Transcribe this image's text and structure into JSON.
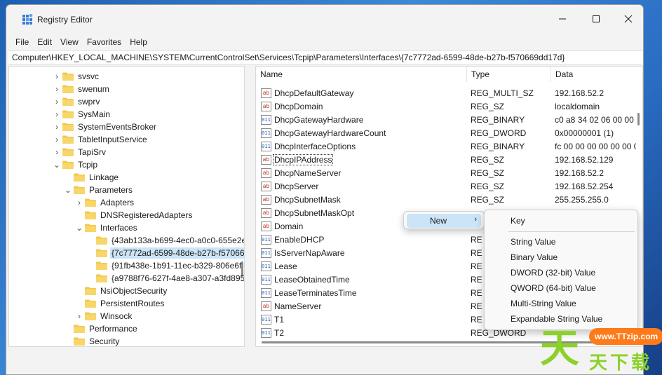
{
  "window": {
    "title": "Registry Editor",
    "controls": {
      "minimize": "—",
      "maximize": "☐",
      "close": "✕"
    }
  },
  "menubar": [
    "File",
    "Edit",
    "View",
    "Favorites",
    "Help"
  ],
  "address": "Computer\\HKEY_LOCAL_MACHINE\\SYSTEM\\CurrentControlSet\\Services\\Tcpip\\Parameters\\Interfaces\\{7c7772ad-6599-48de-b27b-f570669dd17d}",
  "tree": [
    {
      "label": "svsvc",
      "level": 0,
      "expander": "›"
    },
    {
      "label": "swenum",
      "level": 0,
      "expander": "›"
    },
    {
      "label": "swprv",
      "level": 0,
      "expander": "›"
    },
    {
      "label": "SysMain",
      "level": 0,
      "expander": "›"
    },
    {
      "label": "SystemEventsBroker",
      "level": 0,
      "expander": "›"
    },
    {
      "label": "TabletInputService",
      "level": 0,
      "expander": "›"
    },
    {
      "label": "TapiSrv",
      "level": 0,
      "expander": "›"
    },
    {
      "label": "Tcpip",
      "level": 0,
      "expander": "⌄"
    },
    {
      "label": "Linkage",
      "level": 1,
      "expander": ""
    },
    {
      "label": "Parameters",
      "level": 1,
      "expander": "⌄"
    },
    {
      "label": "Adapters",
      "level": 2,
      "expander": "›"
    },
    {
      "label": "DNSRegisteredAdapters",
      "level": 2,
      "expander": ""
    },
    {
      "label": "Interfaces",
      "level": 2,
      "expander": "⌄"
    },
    {
      "label": "{43ab133a-b699-4ec0-a0c0-655e2e",
      "level": 3,
      "expander": ""
    },
    {
      "label": "{7c7772ad-6599-48de-b27b-f57066",
      "level": 3,
      "expander": "",
      "selected": true
    },
    {
      "label": "{91fb438e-1b91-11ec-b329-806e6f",
      "level": 3,
      "expander": ""
    },
    {
      "label": "{a9788f76-627f-4ae8-a307-a3fd895",
      "level": 3,
      "expander": ""
    },
    {
      "label": "NsiObjectSecurity",
      "level": 2,
      "expander": ""
    },
    {
      "label": "PersistentRoutes",
      "level": 2,
      "expander": ""
    },
    {
      "label": "Winsock",
      "level": 2,
      "expander": "›"
    },
    {
      "label": "Performance",
      "level": 1,
      "expander": ""
    },
    {
      "label": "Security",
      "level": 1,
      "expander": ""
    }
  ],
  "list": {
    "columns": [
      "Name",
      "Type",
      "Data"
    ],
    "rows": [
      {
        "name": "DhcpDefaultGateway",
        "type": "REG_MULTI_SZ",
        "data": "192.168.52.2",
        "icon": "sz"
      },
      {
        "name": "DhcpDomain",
        "type": "REG_SZ",
        "data": "localdomain",
        "icon": "sz"
      },
      {
        "name": "DhcpGatewayHardware",
        "type": "REG_BINARY",
        "data": "c0 a8 34 02 06 00 00 0",
        "icon": "bin"
      },
      {
        "name": "DhcpGatewayHardwareCount",
        "type": "REG_DWORD",
        "data": "0x00000001 (1)",
        "icon": "bin"
      },
      {
        "name": "DhcpInterfaceOptions",
        "type": "REG_BINARY",
        "data": "fc 00 00 00 00 00 00 0",
        "icon": "bin"
      },
      {
        "name": "DhcpIPAddress",
        "type": "REG_SZ",
        "data": "192.168.52.129",
        "icon": "sz",
        "focused": true
      },
      {
        "name": "DhcpNameServer",
        "type": "REG_SZ",
        "data": "192.168.52.2",
        "icon": "sz"
      },
      {
        "name": "DhcpServer",
        "type": "REG_SZ",
        "data": "192.168.52.254",
        "icon": "sz"
      },
      {
        "name": "DhcpSubnetMask",
        "type": "REG_SZ",
        "data": "255.255.255.0",
        "icon": "sz"
      },
      {
        "name": "DhcpSubnetMaskOpt",
        "type": "",
        "data": "",
        "icon": "sz"
      },
      {
        "name": "Domain",
        "type": "",
        "data": "",
        "icon": "sz"
      },
      {
        "name": "EnableDHCP",
        "type": "RE",
        "data": "",
        "icon": "bin"
      },
      {
        "name": "IsServerNapAware",
        "type": "RE",
        "data": "",
        "icon": "bin"
      },
      {
        "name": "Lease",
        "type": "RE",
        "data": "",
        "icon": "bin"
      },
      {
        "name": "LeaseObtainedTime",
        "type": "RE",
        "data": "",
        "icon": "bin"
      },
      {
        "name": "LeaseTerminatesTime",
        "type": "RE",
        "data": "",
        "icon": "bin"
      },
      {
        "name": "NameServer",
        "type": "RE",
        "data": "",
        "icon": "sz"
      },
      {
        "name": "T1",
        "type": "RE",
        "data": "",
        "icon": "bin"
      },
      {
        "name": "T2",
        "type": "REG_DWORD",
        "data": "",
        "icon": "bin"
      }
    ]
  },
  "context_menu": {
    "item": "New",
    "arrow": "›",
    "submenu": [
      "Key",
      "String Value",
      "Binary Value",
      "DWORD (32-bit) Value",
      "QWORD (64-bit) Value",
      "Multi-String Value",
      "Expandable String Value"
    ]
  },
  "watermark": {
    "badge": "www.TTzip.com",
    "big": "天",
    "small": "天下载"
  },
  "colors": {
    "selection": "#cce4f7",
    "folder": "#f2c94c",
    "desktop": "#2a6ec4"
  }
}
